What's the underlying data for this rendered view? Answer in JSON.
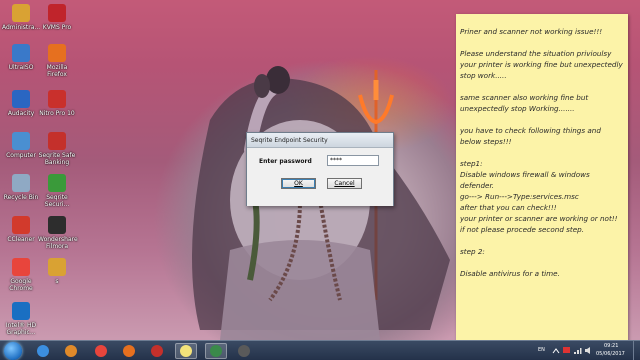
{
  "desktop_icons": [
    {
      "label": "Administra...",
      "color": "#d9a233",
      "glyph": "folder-icon"
    },
    {
      "label": "KVMS Pro",
      "color": "#c0242b",
      "glyph": "kvms-icon"
    },
    {
      "label": "UltraISO",
      "color": "#3a79c9",
      "glyph": "disc-icon"
    },
    {
      "label": "Mozilla Firefox",
      "color": "#e6701f",
      "glyph": "firefox-icon"
    },
    {
      "label": "Audacity",
      "color": "#2a66c2",
      "glyph": "headphones-icon"
    },
    {
      "label": "Nitro Pro 10",
      "color": "#c9302c",
      "glyph": "nitro-icon"
    },
    {
      "label": "Computer",
      "color": "#4a8fd1",
      "glyph": "computer-icon"
    },
    {
      "label": "Seqrite Safe Banking",
      "color": "#c4302b",
      "glyph": "seqrite-icon"
    },
    {
      "label": "Recycle Bin",
      "color": "#8fa9c4",
      "glyph": "recycle-bin-icon"
    },
    {
      "label": "Seqrite Securi...",
      "color": "#3a9a3a",
      "glyph": "seqrite-security-icon"
    },
    {
      "label": "CCleaner",
      "color": "#d23a2c",
      "glyph": "ccleaner-icon"
    },
    {
      "label": "Wondershare Filmora",
      "color": "#2d2d2d",
      "glyph": "filmora-icon"
    },
    {
      "label": "Google Chrome",
      "color": "#e8453c",
      "glyph": "chrome-icon"
    },
    {
      "label": "s",
      "color": "#d9a233",
      "glyph": "folder-icon"
    },
    {
      "label": "Intel® HD Graphic...",
      "color": "#1a6fc2",
      "glyph": "intel-icon"
    }
  ],
  "dialog": {
    "title": "Seqrite Endpoint Security",
    "label": "Enter password",
    "password_value": "****",
    "ok_label": "OK",
    "cancel_label": "Cancel"
  },
  "note": {
    "lines": [
      "Priner and scanner not working issue!!!",
      "",
      "Please understand the situation privioulsy your printer is working fine but unexpectedly stop work.....",
      "",
      "same scanner also working fine but unexpectedly stop Working.......",
      "",
      "you have to check following things and below steps!!!",
      "",
      "step1:",
      "Disable windows firewall & windows defender.",
      "go---> Run--->Type:services.msc",
      "after that you can check!!!",
      "your printer or scanner are working or not!!",
      "if not please procede second step.",
      "",
      "step 2:",
      "",
      "Disable antivirus for a time."
    ]
  },
  "taskbar": {
    "items": [
      {
        "name": "ie-taskbar-icon",
        "color": "#3c8fe0"
      },
      {
        "name": "media-player-taskbar-icon",
        "color": "#e08a2a"
      },
      {
        "name": "chrome-taskbar-icon",
        "color": "#e8453c"
      },
      {
        "name": "firefox-taskbar-icon",
        "color": "#e6701f"
      },
      {
        "name": "seqrite-taskbar-icon",
        "color": "#c4302b"
      },
      {
        "name": "sticky-notes-taskbar-icon",
        "color": "#f3e37a"
      },
      {
        "name": "seqrite-endpoint-taskbar-icon",
        "color": "#3a8a4a"
      },
      {
        "name": "filmora-taskbar-icon",
        "color": "#5a5a5a"
      }
    ],
    "language": "EN",
    "time": "09:21",
    "date": "05/06/2017"
  }
}
